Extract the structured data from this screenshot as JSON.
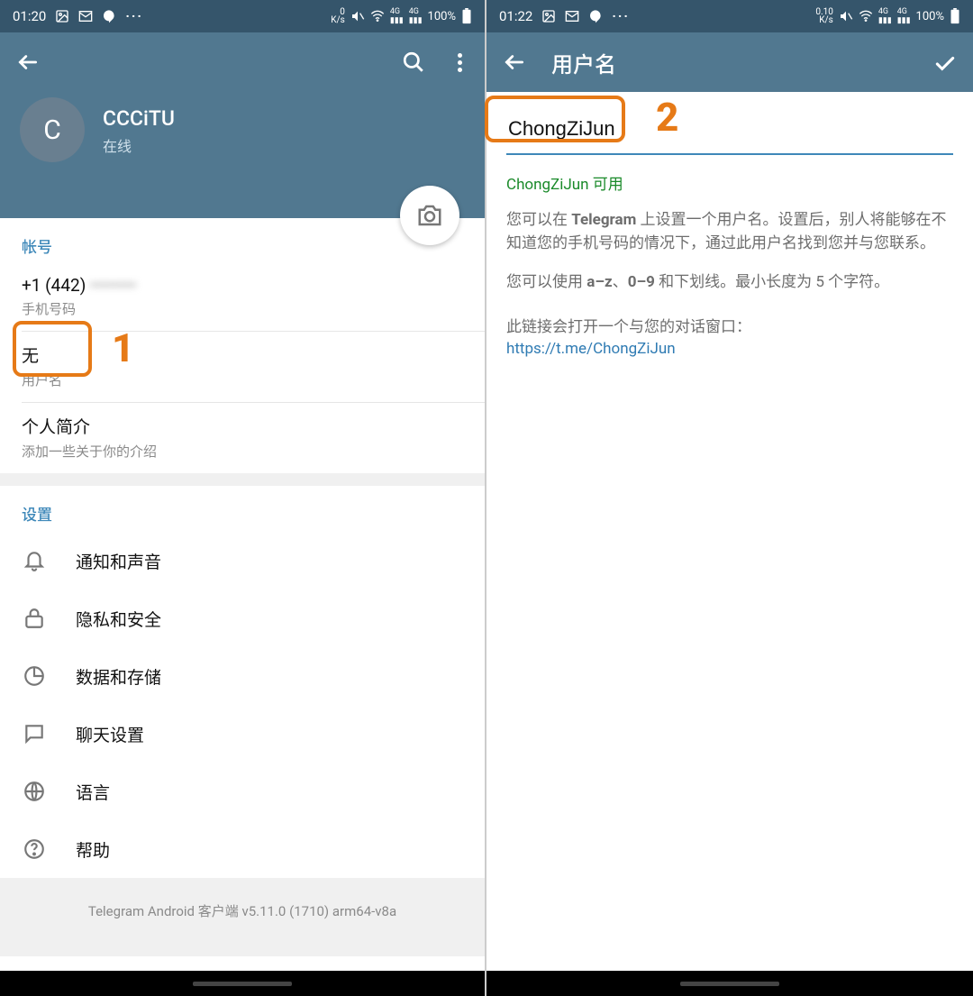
{
  "left": {
    "status": {
      "time": "01:20",
      "speed_top": "0",
      "speed_bot": "K/s",
      "battery": "100%"
    },
    "profile": {
      "avatar_letter": "C",
      "name": "CCCiTU",
      "status": "在线"
    },
    "account": {
      "header": "帐号",
      "phone_visible": "+1 (442)",
      "phone_hidden": "••••••••",
      "phone_label": "手机号码",
      "username_value": "无",
      "username_label": "用户名",
      "bio_value": "个人简介",
      "bio_label": "添加一些关于你的介绍"
    },
    "settings_header": "设置",
    "settings": [
      "通知和声音",
      "隐私和安全",
      "数据和存储",
      "聊天设置",
      "语言",
      "帮助"
    ],
    "footer": "Telegram Android 客户端 v5.11.0 (1710) arm64-v8a",
    "annotation": "1"
  },
  "right": {
    "status": {
      "time": "01:22",
      "speed_top": "0.10",
      "speed_bot": "K/s",
      "battery": "100%"
    },
    "title": "用户名",
    "input_value": "ChongZiJun",
    "available": "ChongZiJun 可用",
    "desc1_a": "您可以在 ",
    "desc1_b": "Telegram",
    "desc1_c": " 上设置一个用户名。设置后，别人将能够在不知道您的手机号码的情况下，通过此用户名找到您并与您联系。",
    "desc2_a": "您可以使用 ",
    "desc2_b": "a–z",
    "desc2_c": "、",
    "desc2_d": "0–9",
    "desc2_e": " 和下划线。最小长度为 5 个字符。",
    "link_label": "此链接会打开一个与您的对话窗口：",
    "link": "https://t.me/ChongZiJun",
    "annotation": "2"
  }
}
